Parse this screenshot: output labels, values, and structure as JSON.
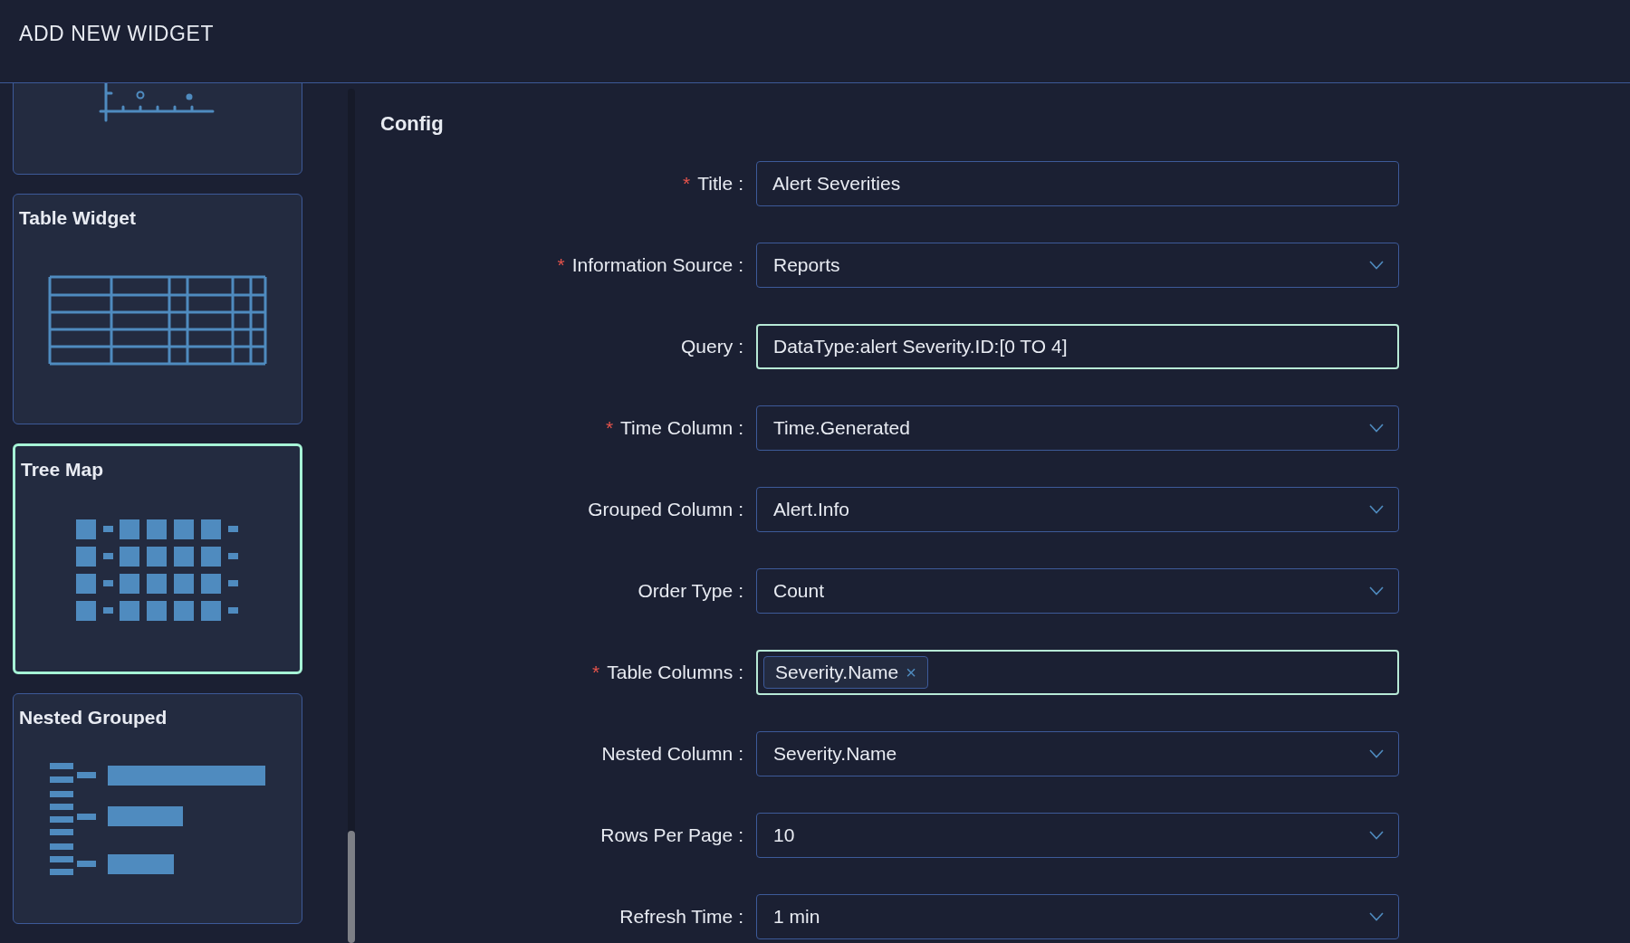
{
  "header": {
    "title": "ADD NEW WIDGET"
  },
  "widgets": [
    {
      "kind": "scatter",
      "selected": false
    },
    {
      "kind": "table",
      "title": "Table Widget",
      "selected": false
    },
    {
      "kind": "treemap",
      "title": "Tree Map",
      "selected": true
    },
    {
      "kind": "nested",
      "title": "Nested Grouped",
      "selected": false
    }
  ],
  "config": {
    "heading": "Config",
    "fields": [
      {
        "required_mark": "*",
        "label": "Title",
        "colon": ":",
        "kind": "text",
        "value": "Alert Severities",
        "focused": false
      },
      {
        "required_mark": "*",
        "label": "Information Source",
        "colon": ":",
        "kind": "select",
        "value": "Reports",
        "focused": false
      },
      {
        "label": "Query",
        "colon": ":",
        "kind": "text",
        "value": "DataType:alert Severity.ID:[0 TO 4]",
        "focused": true
      },
      {
        "required_mark": "*",
        "label": "Time Column",
        "colon": ":",
        "kind": "select",
        "value": "Time.Generated",
        "focused": false
      },
      {
        "label": "Grouped Column",
        "colon": ":",
        "kind": "select",
        "value": "Alert.Info",
        "focused": false
      },
      {
        "label": "Order Type",
        "colon": ":",
        "kind": "select",
        "value": "Count",
        "focused": false
      },
      {
        "required_mark": "*",
        "label": "Table Columns",
        "colon": ":",
        "kind": "tags",
        "tags": [
          "Severity.Name"
        ],
        "remove": "×",
        "focused": true
      },
      {
        "label": "Nested Column",
        "colon": ":",
        "kind": "select",
        "value": "Severity.Name",
        "focused": false
      },
      {
        "label": "Rows Per Page",
        "colon": ":",
        "kind": "select",
        "value": "10",
        "focused": false
      },
      {
        "label": "Refresh Time",
        "colon": ":",
        "kind": "select",
        "value": "1 min",
        "focused": false
      }
    ]
  }
}
